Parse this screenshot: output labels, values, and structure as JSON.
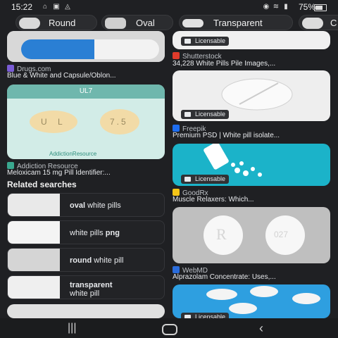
{
  "status": {
    "time": "15:22",
    "battery": "75%"
  },
  "chips": [
    {
      "label": "Round"
    },
    {
      "label": "Oval"
    },
    {
      "label": "Transparent"
    },
    {
      "label": "C"
    }
  ],
  "left_results": [
    {
      "source": "Drugs.com",
      "title": "Blue & White and Capsule/Oblon..."
    },
    {
      "source": "Addiction Resource",
      "title": "Meloxicam 15 mg Pill Identifier:...",
      "image_text": [
        "UL7",
        "U L",
        "7.5",
        "AddictionResource"
      ]
    }
  ],
  "related": {
    "title": "Related searches",
    "items": [
      {
        "bold": "oval",
        "rest": " white pills"
      },
      {
        "plain": "white pills ",
        "bold": "png"
      },
      {
        "bold": "round",
        "rest": " white pill"
      },
      {
        "bold": "transparent",
        "rest": "white pill"
      }
    ]
  },
  "right_results": [
    {
      "badge": "Licensable",
      "source": "Shutterstock",
      "title": "34,228 White Pills Pile Images,...",
      "fav_color": "#e03b2b"
    },
    {
      "badge": "Licensable",
      "source": "Freepik",
      "title": "Premium PSD | White pill isolate...",
      "fav_color": "#1e6ef0"
    },
    {
      "badge": "Licensable",
      "source": "GoodRx",
      "title": "Muscle Relaxers: Which...",
      "fav_color": "#f5c518"
    },
    {
      "badge": "",
      "source": "WebMD",
      "title": "Alprazolam Concentrate: Uses,...",
      "fav_color": "#2a6cdb",
      "image_text": [
        "R",
        "027"
      ]
    },
    {
      "badge": "Licensable",
      "source": "",
      "title": ""
    }
  ],
  "colors": {
    "background": "#1f2023",
    "cyan_bg": "#1bb3c9",
    "teal_card": "#cfe9e4"
  }
}
